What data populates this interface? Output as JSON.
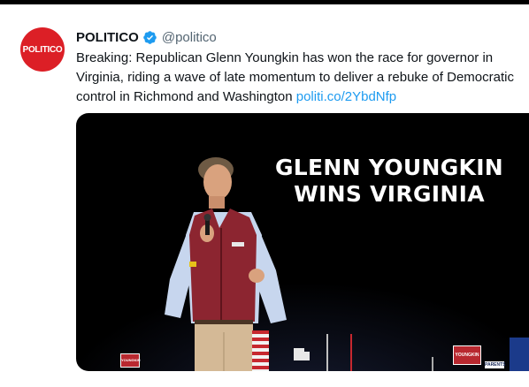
{
  "tweet": {
    "avatar_text": "POLITICO",
    "display_name": "POLITICO",
    "handle": "@politico",
    "verified_icon": "verified-badge-icon",
    "text_lines": [
      "Breaking: Republican Glenn Youngkin has won the race for governor in",
      "Virginia, riding a wave of late momentum to deliver a rebuke of Democratic",
      "control in Richmond and Washington "
    ],
    "link_text": "politi.co/2YbdNfp",
    "colors": {
      "avatar_bg": "#dc1f26",
      "verified": "#1d9bf0",
      "link": "#1d9bf0",
      "handle": "#536471"
    }
  },
  "media": {
    "headline_line1": "GLENN YOUNGKIN",
    "headline_line2": "WINS VIRGINIA",
    "sign_left": "YOUNGKIN",
    "sign_right": "YOUNGKIN",
    "sign_parents": "PARENTS"
  }
}
